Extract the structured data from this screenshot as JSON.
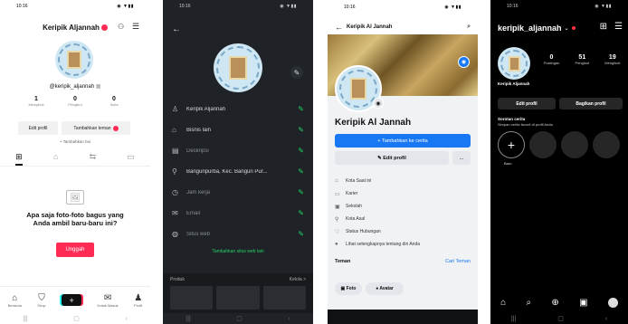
{
  "status_bar": {
    "time": "10:16",
    "icons": "◉ ▼▮▮"
  },
  "tiktok": {
    "header_name": "Keripik Aljannah",
    "handle": "@keripik_aljannah",
    "stats": [
      {
        "value": "1",
        "label": "Mengikuti"
      },
      {
        "value": "0",
        "label": "Pengikut"
      },
      {
        "value": "0",
        "label": "Suka"
      }
    ],
    "edit_profile": "Edit profil",
    "add_friends": "Tambahkan teman",
    "add_bio": "+ Tambahkan bio",
    "empty_text": "Apa saja foto-foto bagus yang Anda ambil baru-baru ini?",
    "upload": "Unggah",
    "nav": [
      {
        "label": "Beranda",
        "icon": "home-icon"
      },
      {
        "label": "Shop",
        "icon": "shop-icon"
      },
      {
        "label": "",
        "icon": "plus-icon"
      },
      {
        "label": "Kotak Masuk",
        "icon": "inbox-icon"
      },
      {
        "label": "Profil",
        "icon": "profile-icon"
      }
    ]
  },
  "whatsapp": {
    "rows": [
      {
        "icon": "person-icon",
        "text": "Keripik Aljannah",
        "muted": false
      },
      {
        "icon": "store-icon",
        "text": "Bisnis lain",
        "muted": false
      },
      {
        "icon": "document-icon",
        "text": "Deskripsi",
        "muted": true
      },
      {
        "icon": "location-icon",
        "text": "Bangunpurba, Kec. Bangun Pur...",
        "muted": false
      },
      {
        "icon": "clock-icon",
        "text": "Jam kerja",
        "muted": true
      },
      {
        "icon": "email-icon",
        "text": "Email",
        "muted": true
      },
      {
        "icon": "globe-icon",
        "text": "Situs web",
        "muted": true
      }
    ],
    "add_website": "Tambahkan situs web lain",
    "products_label": "Produk",
    "products_manage": "Kelola >"
  },
  "facebook": {
    "title": "Keripik Al Jannah",
    "page_name": "Keripik Al Jannah",
    "add_story": "+ Tambahkan ke cerita",
    "edit_profile": "✎ Edit profil",
    "more": "...",
    "info": [
      {
        "icon": "home-icon",
        "text": "Kota Saat ini"
      },
      {
        "icon": "briefcase-icon",
        "text": "Karier"
      },
      {
        "icon": "school-icon",
        "text": "Sekolah"
      },
      {
        "icon": "location-icon",
        "text": "Kota Asal"
      },
      {
        "icon": "heart-icon",
        "text": "Status Hubungan"
      },
      {
        "icon": "info-icon",
        "text": "Lihat selengkapnya tentang diri Anda"
      }
    ],
    "friends": "Teman",
    "find_friends": "Cari Teman",
    "photo_chip": "▣ Foto",
    "avatar_chip": "● Avatar"
  },
  "instagram": {
    "username": "keripik_aljannah",
    "stats": [
      {
        "value": "0",
        "label": "Postingan"
      },
      {
        "value": "51",
        "label": "Pengikut"
      },
      {
        "value": "19",
        "label": "Mengikuti"
      }
    ],
    "display_name": "Keripik Aljannah",
    "edit_profile": "Edit profil",
    "share_profile": "Bagikan profil",
    "highlights_title": "Sorotan cerita",
    "highlights_sub": "Simpan cerita favorit di profil Anda",
    "new_label": "Baru"
  }
}
